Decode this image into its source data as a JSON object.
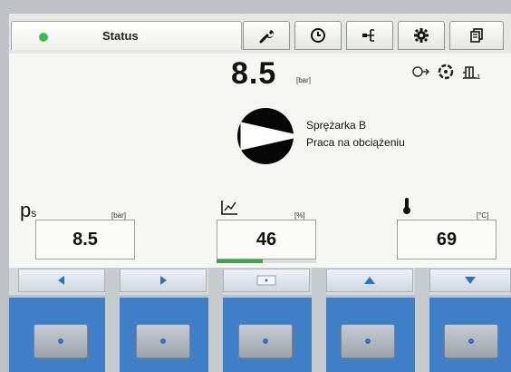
{
  "status_tab": {
    "label": "Status",
    "led_color": "#37c24b"
  },
  "tabs": [
    {
      "icon": "wrench-icon"
    },
    {
      "icon": "clock-icon"
    },
    {
      "icon": "network-icon"
    },
    {
      "icon": "gear-icon"
    },
    {
      "icon": "documents-icon"
    }
  ],
  "pressure_top": {
    "value": "8.5",
    "unit": "[bar]"
  },
  "top_icons": [
    "motor-icon",
    "fan-icon",
    "sensor-1-icon"
  ],
  "compressor": {
    "name": "Sprężarka B",
    "state": "Praca na obciążeniu"
  },
  "readouts": {
    "pressure": {
      "label": "p",
      "subscript": "s",
      "unit": "[bar]",
      "value": "8.5"
    },
    "load": {
      "icon": "load-chart-icon",
      "unit": "[%]",
      "value": "46",
      "progress_percent": 46,
      "bar_color": "#3aa84a"
    },
    "temperature": {
      "icon": "thermometer-icon",
      "unit": "[°C]",
      "value": "69"
    }
  },
  "nav_buttons": [
    "arrow-left-icon",
    "arrow-right-icon",
    "select-icon",
    "arrow-up-icon",
    "arrow-down-icon"
  ],
  "function_keys": [
    "key-1",
    "key-2",
    "key-3",
    "key-4",
    "key-5"
  ],
  "colors": {
    "accent_blue": "#3f7fc8",
    "nav_arrow": "#2f72c4"
  }
}
